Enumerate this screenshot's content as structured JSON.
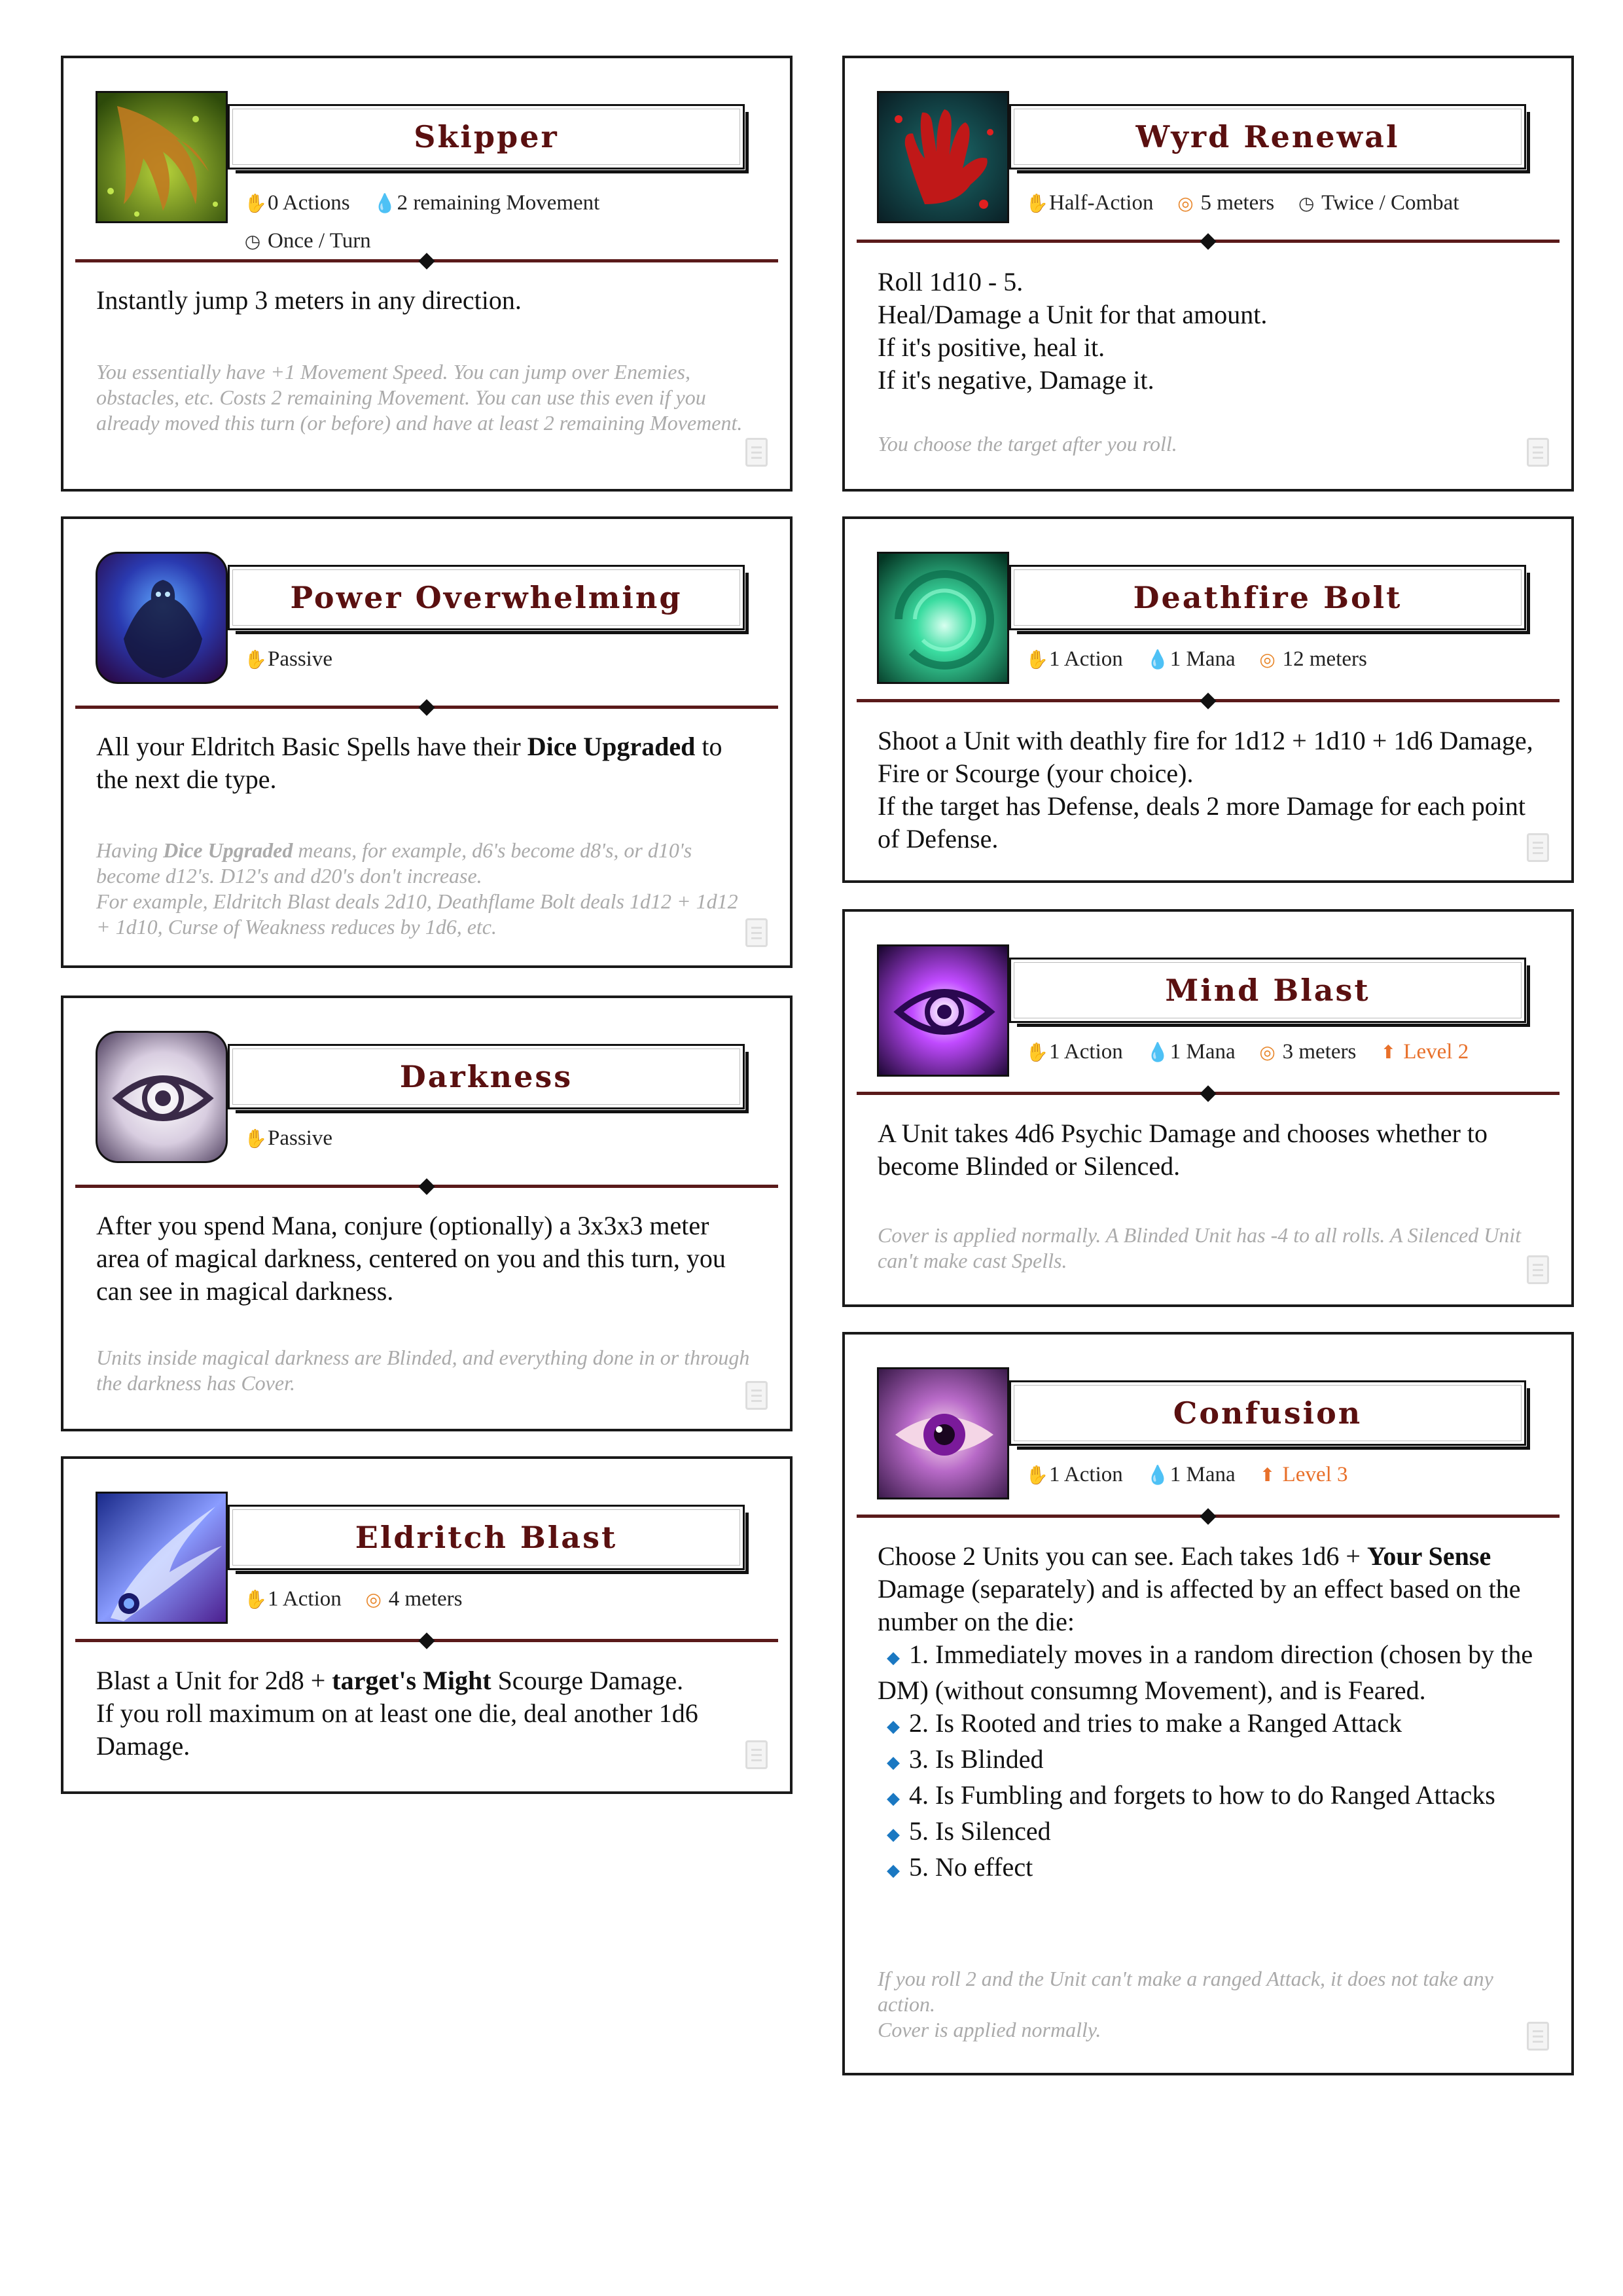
{
  "cards": {
    "skipper": {
      "title": "Skipper",
      "action": "0 Actions",
      "movement": "2 remaining Movement",
      "frequency": "Once / Turn",
      "text": "Instantly jump 3 meters in any direction.",
      "note": "You essentially have +1 Movement Speed. You can jump over Enemies, obstacles, etc. Costs 2 remaining Movement. You can use this even if you already moved this turn (or before) and have at least 2 remaining Movement."
    },
    "wyrd_renewal": {
      "title": "Wyrd Renewal",
      "action": "Half-Action",
      "range": "5 meters",
      "frequency": "Twice / Combat",
      "text": "Roll 1d10 - 5.\nHeal/Damage a Unit for that amount.\nIf it's positive, heal it.\nIf it's negative, Damage it.",
      "note": "You choose the target after you roll."
    },
    "power_overwhelming": {
      "title": "Power Overwhelming",
      "action": "Passive",
      "text_a": "All your Eldritch Basic Spells have their ",
      "text_bold": "Dice Upgraded",
      "text_b": " to the next die type.",
      "note_a": "Having ",
      "note_bold": "Dice Upgraded",
      "note_b": " means, for example, d6's become d8's, or d10's become d12's. D12's and d20's don't increase.\nFor example, Eldritch Blast deals 2d10, Deathflame Bolt deals 1d12 + 1d12 + 1d10, Curse of Weakness reduces by 1d6, etc."
    },
    "deathfire_bolt": {
      "title": "Deathfire Bolt",
      "action": "1 Action",
      "cost": "1 Mana",
      "range": "12 meters",
      "text": "Shoot a Unit with deathly fire for 1d12 + 1d10 + 1d6 Damage, Fire or Scourge (your choice).\nIf the target has Defense, deals 2 more Damage for each point of Defense."
    },
    "darkness": {
      "title": "Darkness",
      "action": "Passive",
      "text": "After you spend Mana, conjure (optionally) a 3x3x3 meter area of magical darkness, centered on you and this turn, you can see in magical darkness.",
      "note": "Units inside magical darkness are Blinded, and everything done in or through the darkness has Cover."
    },
    "mind_blast": {
      "title": "Mind Blast",
      "action": "1 Action",
      "cost": "1 Mana",
      "range": "3 meters",
      "level": "Level 2",
      "text": "A Unit takes 4d6 Psychic Damage and chooses whether to become Blinded or Silenced.",
      "note": "Cover is applied normally. A Blinded Unit has -4 to all rolls. A Silenced Unit can't make cast Spells."
    },
    "eldritch_blast": {
      "title": "Eldritch Blast",
      "action": "1 Action",
      "range": "4 meters",
      "text_a": "Blast a Unit for 2d8 + ",
      "text_bold": "target's Might",
      "text_b": " Scourge Damage.\nIf you roll maximum on at least one die, deal another 1d6 Damage."
    },
    "confusion": {
      "title": "Confusion",
      "action": "1 Action",
      "cost": "1 Mana",
      "level": "Level 3",
      "text_a": "Choose 2 Units you can see. Each takes 1d6 + ",
      "text_bold": "Your Sense",
      "text_b": " Damage (separately) and is affected by an effect based on the number on the die:",
      "items": [
        "1. Immediately moves in a random direction (chosen by the DM) (without consumng Movement), and is Feared.",
        "2. Is Rooted and tries to make a Ranged Attack",
        "3. Is Blinded",
        "4. Is Fumbling and forgets to how to do Ranged Attacks",
        "5. Is Silenced",
        "5. No effect"
      ],
      "note": "If you roll 2 and the Unit can't make a ranged Attack, it does not take any action.\nCover is applied normally."
    }
  },
  "icons": {
    "action": "hand-icon",
    "movement": "drop-icon",
    "mana": "drop-icon",
    "range": "range-icon",
    "frequency": "clock-icon",
    "level": "level-icon",
    "page": "page-icon"
  },
  "colors": {
    "title": "#5a1010",
    "divider": "#5a1a1a",
    "note": "#aaaaaa",
    "level": "#e8702a",
    "hand": "#e6a817",
    "mana": "#2d9fd0",
    "bullet": "#1a78c2"
  }
}
